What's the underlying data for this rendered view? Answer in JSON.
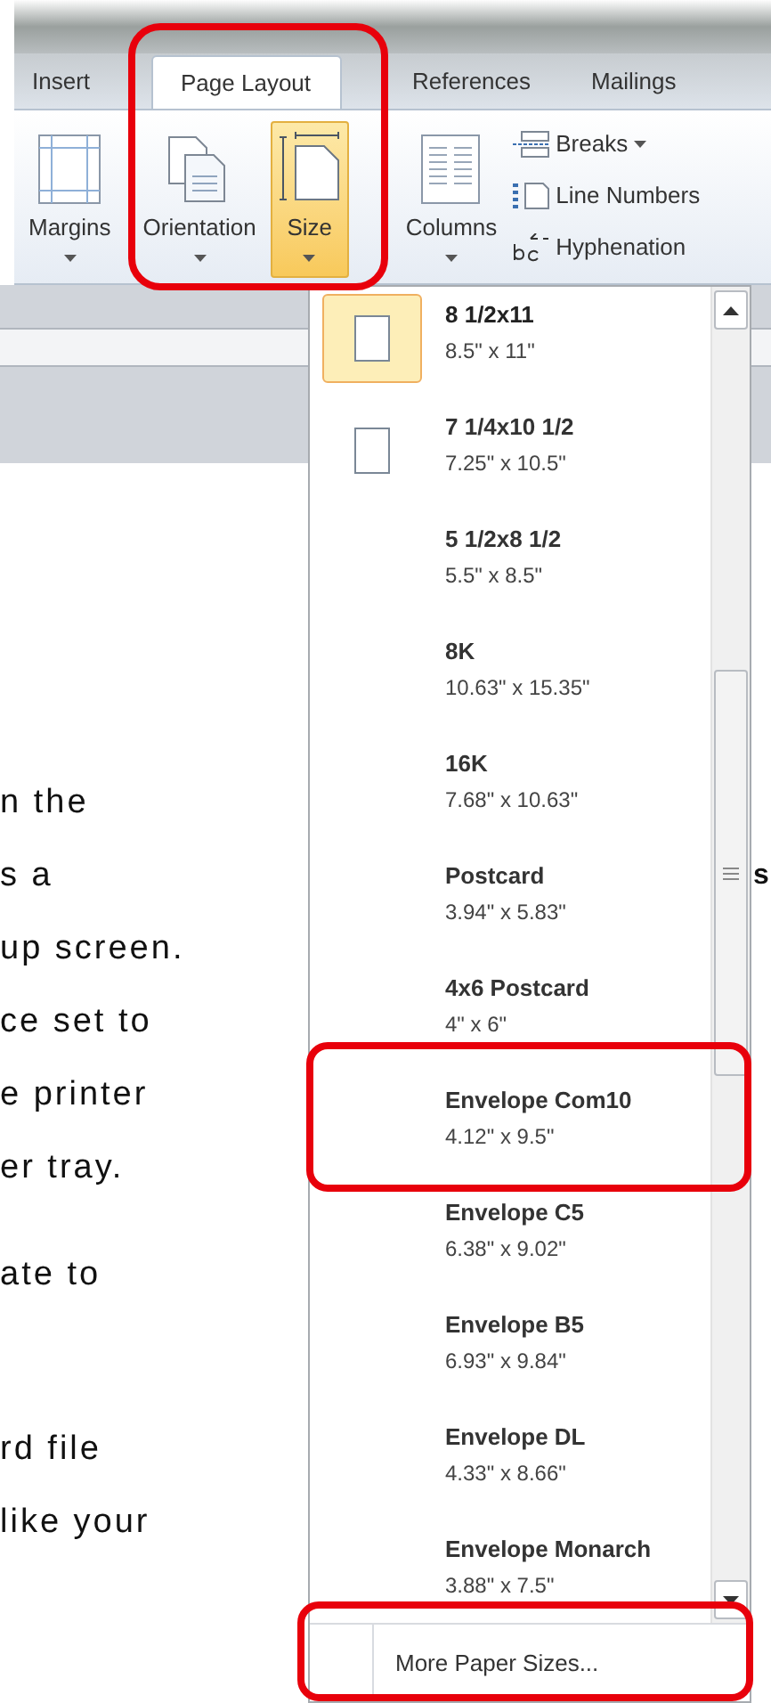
{
  "tabs": [
    {
      "label": "Insert",
      "selected": false
    },
    {
      "label": "Page Layout",
      "selected": true
    },
    {
      "label": "References",
      "selected": false
    },
    {
      "label": "Mailings",
      "selected": false
    }
  ],
  "ribbon": {
    "large_buttons": [
      {
        "kind": "margins",
        "label": "Margins",
        "active": false
      },
      {
        "kind": "orientation",
        "label": "Orientation",
        "active": false
      },
      {
        "kind": "size",
        "label": "Size",
        "active": true
      },
      {
        "kind": "columns",
        "label": "Columns",
        "active": false
      }
    ],
    "small_buttons": [
      {
        "kind": "breaks",
        "label": "Breaks",
        "dropdown": true
      },
      {
        "kind": "line-numbers",
        "label": "Line Numbers",
        "dropdown": false
      },
      {
        "kind": "hyphenation",
        "label": "Hyphenation",
        "dropdown": false
      }
    ]
  },
  "document": {
    "paragraphs": [
      [
        "n the",
        "s a",
        "up screen.",
        "ce set to",
        "e printer",
        "er tray."
      ],
      [
        "ate to"
      ],
      [
        "rd file",
        "like your"
      ]
    ],
    "side_text": "s"
  },
  "size_menu": {
    "items": [
      {
        "name": "8 1/2x11",
        "dims": "8.5\" x 11\"",
        "selected": true,
        "icon": true
      },
      {
        "name": "7 1/4x10 1/2",
        "dims": "7.25\" x 10.5\"",
        "selected": false,
        "icon": true
      },
      {
        "name": "5 1/2x8 1/2",
        "dims": "5.5\" x 8.5\"",
        "selected": false,
        "icon": false
      },
      {
        "name": "8K",
        "dims": "10.63\" x 15.35\"",
        "selected": false,
        "icon": false
      },
      {
        "name": "16K",
        "dims": "7.68\" x 10.63\"",
        "selected": false,
        "icon": false
      },
      {
        "name": "Postcard",
        "dims": "3.94\" x 5.83\"",
        "selected": false,
        "icon": false
      },
      {
        "name": "4x6 Postcard",
        "dims": "4\" x 6\"",
        "selected": false,
        "icon": false
      },
      {
        "name": "Envelope Com10",
        "dims": "4.12\" x 9.5\"",
        "selected": false,
        "icon": false
      },
      {
        "name": "Envelope C5",
        "dims": "6.38\" x 9.02\"",
        "selected": false,
        "icon": false
      },
      {
        "name": "Envelope B5",
        "dims": "6.93\" x 9.84\"",
        "selected": false,
        "icon": false
      },
      {
        "name": "Envelope DL",
        "dims": "4.33\" x 8.66\"",
        "selected": false,
        "icon": false
      },
      {
        "name": "Envelope Monarch",
        "dims": "3.88\" x 7.5\"",
        "selected": false,
        "icon": false
      }
    ],
    "more_label": "More Paper Sizes..."
  }
}
